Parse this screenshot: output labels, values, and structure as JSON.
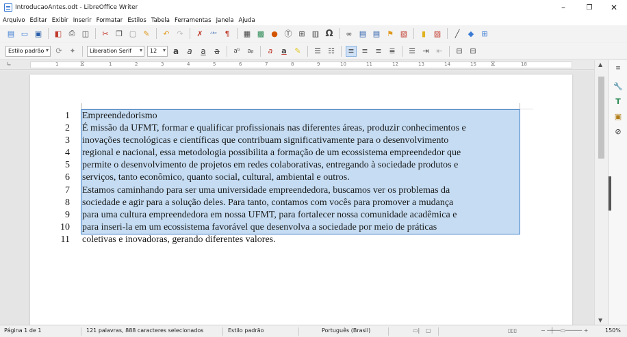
{
  "window": {
    "title": "IntroducaoAntes.odt - LibreOffice Writer",
    "controls": [
      "–",
      "❐",
      "✕"
    ]
  },
  "menu": [
    "Arquivo",
    "Editar",
    "Exibir",
    "Inserir",
    "Formatar",
    "Estilos",
    "Tabela",
    "Ferramentas",
    "Janela",
    "Ajuda"
  ],
  "toolbar1": {
    "icons": [
      "new-doc-icon",
      "template-icon",
      "save-icon",
      "pdf-icon",
      "print-icon",
      "print-preview-icon",
      "cut-icon",
      "copy-icon",
      "paste-icon",
      "clone-icon",
      "undo-icon",
      "redo-icon",
      "find-icon",
      "spellcheck-icon",
      "formatting-marks-icon",
      "table-icon",
      "image-icon",
      "chart-icon",
      "textbox-icon",
      "page-break-icon",
      "field-icon",
      "special-char-icon",
      "hyperlink-icon",
      "footnote-icon",
      "endnote-icon",
      "bookmark-icon",
      "cross-ref-icon",
      "comment-icon",
      "track-changes-icon",
      "line-icon",
      "shapes-icon",
      "draw-functions-icon"
    ]
  },
  "toolbar2": {
    "paragraph_style": "Estilo padrão",
    "font_name": "Liberation Serif",
    "font_size": "12"
  },
  "ruler": {
    "marks": [
      "1",
      "1",
      "2",
      "3",
      "4",
      "5",
      "6",
      "7",
      "8",
      "9",
      "10",
      "11",
      "12",
      "13",
      "14",
      "15",
      "16",
      "18"
    ]
  },
  "document": {
    "lines": [
      {
        "n": "1",
        "text": "Empreendedorismo"
      },
      {
        "n": "2",
        "text": "É missão da UFMT, formar e qualificar profissionais nas diferentes áreas, produzir conhecimentos e"
      },
      {
        "n": "3",
        "text": "inovações tecnológicas e científicas que contribuam significativamente para o desenvolvimento"
      },
      {
        "n": "4",
        "text": "regional e nacional, essa metodologia possibilita a formação de um ecossistema empreendedor que"
      },
      {
        "n": "5",
        "text": "permite o desenvolvimento de projetos em redes colaborativas, entregando à sociedade produtos e"
      },
      {
        "n": "6",
        "text": "serviços, tanto econômico, quanto social, cultural, ambiental e outros."
      },
      {
        "n": "7",
        "text": "Estamos caminhando para ser uma universidade empreendedora, buscamos ver os problemas da"
      },
      {
        "n": "8",
        "text": "sociedade e agir para a solução deles. Para tanto, contamos com vocês para promover a mudança"
      },
      {
        "n": "9",
        "text": "para uma cultura empreendedora em nossa UFMT, para fortalecer nossa comunidade acadêmica e"
      },
      {
        "n": "10",
        "text": "para inseri-la em um ecossistema favorável que desenvolva a sociedade por meio de práticas"
      },
      {
        "n": "11",
        "text": "coletivas e inovadoras, gerando diferentes valores."
      }
    ]
  },
  "statusbar": {
    "page": "Página 1 de 1",
    "words": "121 palavras, 888 caracteres selecionados",
    "style": "Estilo padrão",
    "language": "Português (Brasil)",
    "zoom": "150%"
  }
}
